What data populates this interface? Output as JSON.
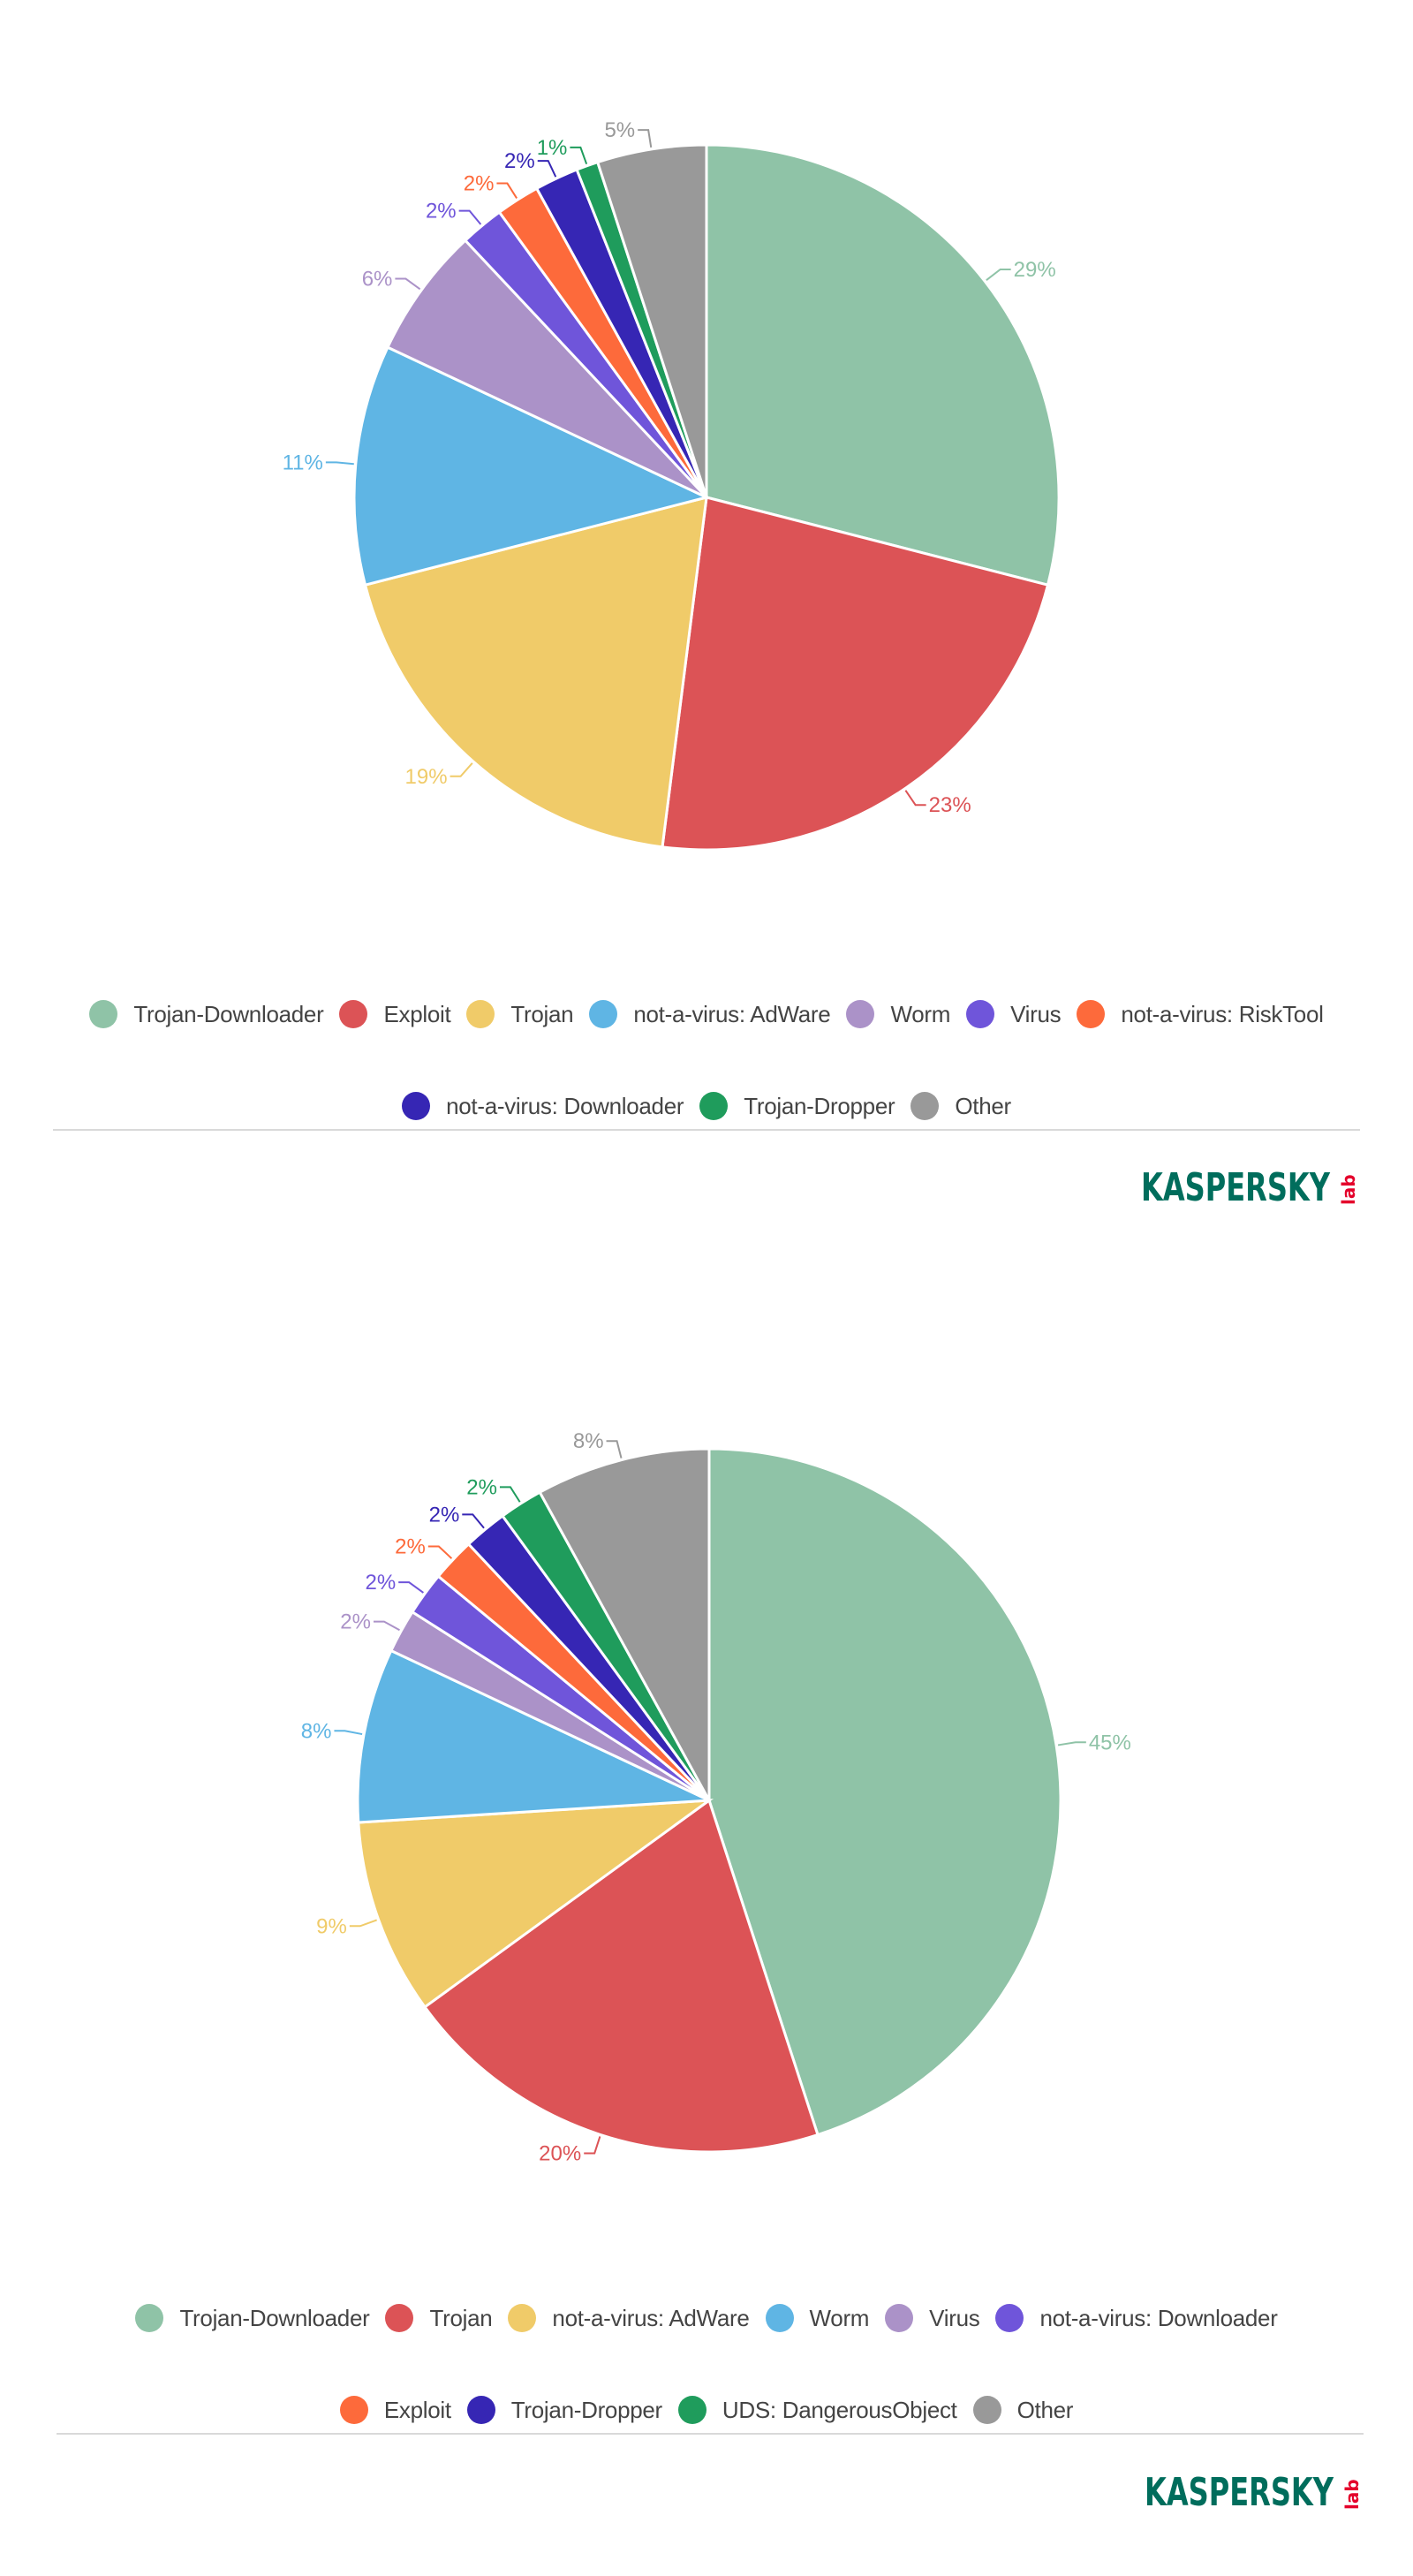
{
  "colors": {
    "trojan_downloader": "#8fc3a7",
    "red": "#dc5356",
    "yellow": "#f0cb69",
    "blue": "#5fb5e4",
    "lavender": "#ab92c8",
    "violet": "#6f55da",
    "orange": "#fd6a3b",
    "indigo": "#3626b4",
    "green": "#1f9c5c",
    "gray": "#999999",
    "divider": "#d9d9d9",
    "legend_text": "#444444",
    "logo_green": "#006d5c",
    "logo_red": "#e4002b"
  },
  "logo": {
    "wordmark": "KASPERSKY",
    "suffix": "lab"
  },
  "chart_data": [
    {
      "type": "pie",
      "title": "",
      "direction": "clockwise from 12 o'clock",
      "legend_position": "bottom-center",
      "categories": [
        "Trojan-Downloader",
        "Exploit",
        "Trojan",
        "not-a-virus: AdWare",
        "Worm",
        "Virus",
        "not-a-virus: RiskTool",
        "not-a-virus: Downloader",
        "Trojan-Dropper",
        "Other"
      ],
      "values": [
        29,
        23,
        19,
        11,
        6,
        2,
        2,
        2,
        1,
        5
      ],
      "labels": [
        "29%",
        "23%",
        "19%",
        "11%",
        "6%",
        "2%",
        "2%",
        "2%",
        "1%",
        "5%"
      ],
      "colors": [
        "#8fc3a7",
        "#dc5356",
        "#f0cb69",
        "#5fb5e4",
        "#ab92c8",
        "#6f55da",
        "#fd6a3b",
        "#3626b4",
        "#1f9c5c",
        "#999999"
      ],
      "legend_rows": [
        [
          0,
          1,
          2,
          3,
          4,
          5,
          6
        ],
        [
          7,
          8,
          9
        ]
      ]
    },
    {
      "type": "pie",
      "title": "",
      "direction": "clockwise from 12 o'clock",
      "legend_position": "bottom-center",
      "categories": [
        "Trojan-Downloader",
        "Trojan",
        "not-a-virus: AdWare",
        "Worm",
        "Virus",
        "not-a-virus: Downloader",
        "Exploit",
        "Trojan-Dropper",
        "UDS: DangerousObject",
        "Other"
      ],
      "values": [
        45,
        20,
        9,
        8,
        2,
        2,
        2,
        2,
        2,
        8
      ],
      "labels": [
        "45%",
        "20%",
        "9%",
        "8%",
        "2%",
        "2%",
        "2%",
        "2%",
        "2%",
        "8%"
      ],
      "colors": [
        "#8fc3a7",
        "#dc5356",
        "#f0cb69",
        "#5fb5e4",
        "#ab92c8",
        "#6f55da",
        "#fd6a3b",
        "#3626b4",
        "#1f9c5c",
        "#999999"
      ],
      "legend_rows": [
        [
          0,
          1,
          2,
          3,
          4,
          5
        ],
        [
          6,
          7,
          8,
          9
        ]
      ]
    }
  ]
}
